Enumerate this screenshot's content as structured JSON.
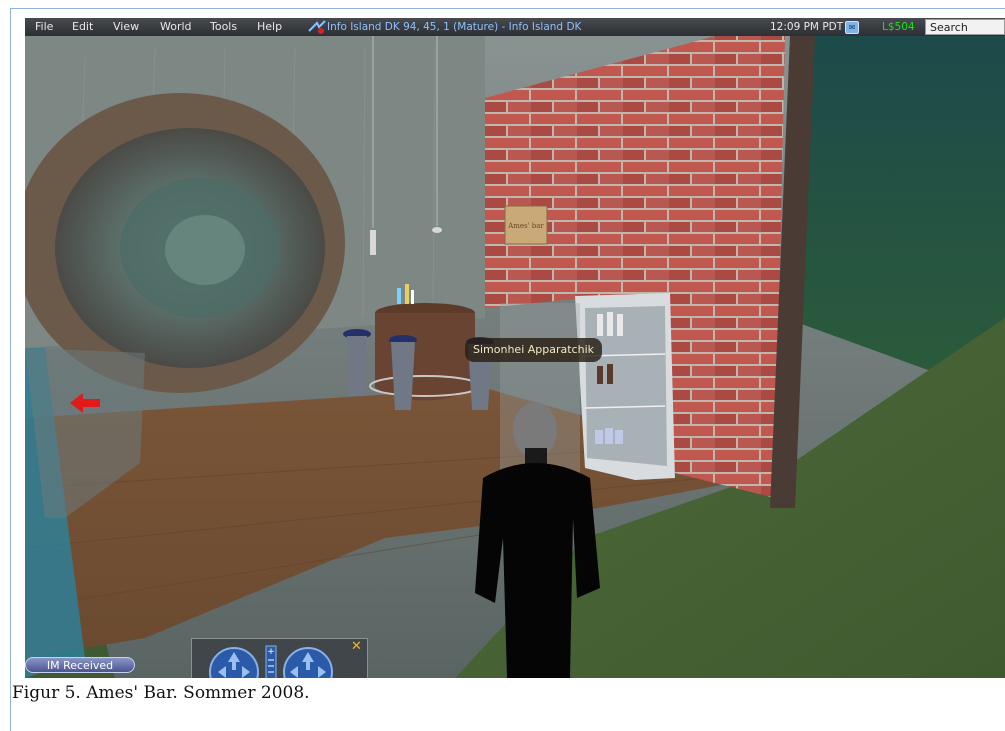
{
  "menu": {
    "items": [
      "File",
      "Edit",
      "View",
      "World",
      "Tools",
      "Help"
    ],
    "location": "Info Island DK 94, 45, 1 (Mature) - Info Island DK",
    "clock": "12:09 PM PDT",
    "balance": "L$504",
    "search_label": "Search"
  },
  "scene": {
    "avatar_name": "Simonhei Apparatchik",
    "sign_text": "Ames' bar"
  },
  "hud": {
    "im_received_label": "IM Received",
    "close_glyph": "✕"
  },
  "caption": "Figur 5. Ames' Bar. Sommer 2008.",
  "colors": {
    "menubar": "#34383d",
    "location_text": "#8fc0ff",
    "balance_text": "#18e418",
    "caption_text": "#111111"
  },
  "icons": [
    "teleport-arrow-icon",
    "im-icon",
    "red-arrow-icon",
    "joystick-icon",
    "close-icon"
  ]
}
